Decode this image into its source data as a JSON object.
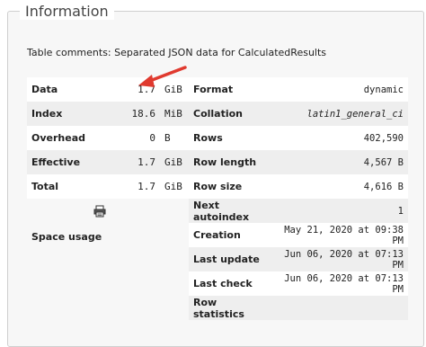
{
  "panel": {
    "legend": "Information",
    "comments": "Table comments: Separated JSON data for CalculatedResults"
  },
  "space_usage": {
    "rows": [
      {
        "label": "Data",
        "value": "1.7",
        "unit": "GiB"
      },
      {
        "label": "Index",
        "value": "18.6",
        "unit": "MiB"
      },
      {
        "label": "Overhead",
        "value": "0",
        "unit": "B"
      },
      {
        "label": "Effective",
        "value": "1.7",
        "unit": "GiB"
      },
      {
        "label": "Total",
        "value": "1.7",
        "unit": "GiB"
      }
    ],
    "heading": "Space usage",
    "print_icon": "printer-icon"
  },
  "row_statistics": {
    "rows": [
      {
        "label": "Format",
        "value": "dynamic"
      },
      {
        "label": "Collation",
        "value": "latin1_general_ci"
      },
      {
        "label": "Rows",
        "value": "402,590"
      },
      {
        "label": "Row length",
        "value": "4,567 B"
      },
      {
        "label": "Row size",
        "value": "4,616 B"
      },
      {
        "label": "Next autoindex",
        "value": "1"
      },
      {
        "label": "Creation",
        "value": "May 21, 2020 at 09:38 PM"
      },
      {
        "label": "Last update",
        "value": "Jun 06, 2020 at 07:13 PM"
      },
      {
        "label": "Last check",
        "value": "Jun 06, 2020 at 07:13 PM"
      },
      {
        "label": "Row statistics",
        "value": ""
      }
    ]
  },
  "annotation": {
    "arrow_color": "#e03a2f",
    "arrow_icon": "red-arrow-icon"
  }
}
